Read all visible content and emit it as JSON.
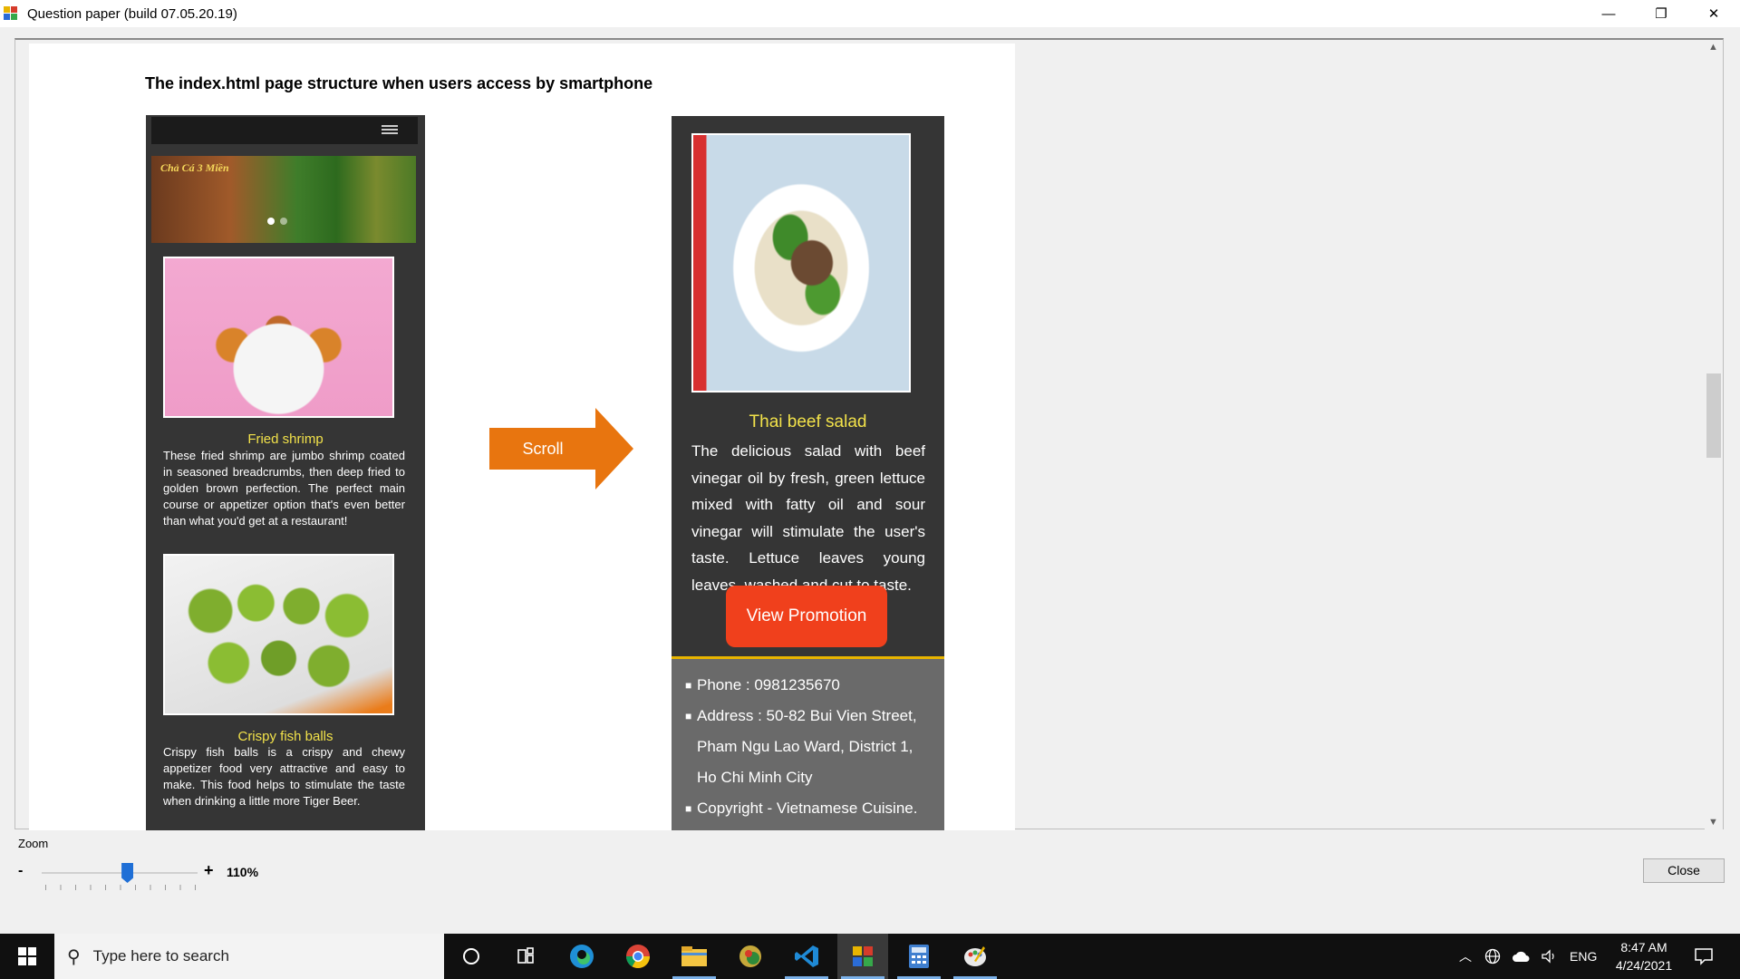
{
  "window": {
    "title": "Question paper (build 07.05.20.19)",
    "minimize": "—",
    "restore": "❐",
    "close": "✕"
  },
  "document": {
    "heading": "The index.html page structure when users access by smartphone",
    "left_phone": {
      "banner_text": "Chả Cá 3 Miền",
      "items": [
        {
          "title": "Fried shrimp",
          "description": "These fried shrimp are jumbo shrimp coated in seasoned breadcrumbs, then deep fried to golden brown perfection. The perfect main course or appetizer option that's even better than what you'd get at a restaurant!"
        },
        {
          "title": "Crispy fish balls",
          "description": "Crispy fish balls is a crispy and chewy appetizer food very attractive and easy to make. This food helps to stimulate the taste when drinking a little more Tiger Beer."
        }
      ]
    },
    "scroll_arrow_label": "Scroll",
    "right_phone": {
      "title": "Thai beef salad",
      "description": "The delicious salad with beef vinegar oil by fresh, green lettuce mixed with fatty oil and sour vinegar will stimulate the user's taste. Lettuce leaves young leaves, washed and cut to taste.",
      "button_label": "View Promotion Food",
      "footer_items": [
        "Phone : 0981235670",
        "Address : 50-82 Bui Vien Street, Pham Ngu Lao Ward, District 1, Ho Chi Minh City",
        "Copyright - Vietnamese Cuisine. All rights Reserved"
      ]
    }
  },
  "zoom": {
    "label": "Zoom",
    "minus": "-",
    "plus": "+",
    "value_text": "110%",
    "level_fraction": 0.55
  },
  "dialog": {
    "close_label": "Close"
  },
  "taskbar": {
    "search_placeholder": "Type here to search",
    "language": "ENG",
    "time": "8:47 AM",
    "date": "4/24/2021",
    "apps": [
      "cortana-icon",
      "task-view-icon",
      "edge-icon",
      "chrome-icon",
      "file-explorer-icon",
      "browser-icon",
      "vscode-icon",
      "exam-app-icon",
      "calculator-icon",
      "paint-icon"
    ]
  },
  "colors": {
    "accent_orange": "#e8750f",
    "promo_button": "#f0401c",
    "item_title_yellow": "#f2e24a",
    "phone_bg": "#353535"
  }
}
